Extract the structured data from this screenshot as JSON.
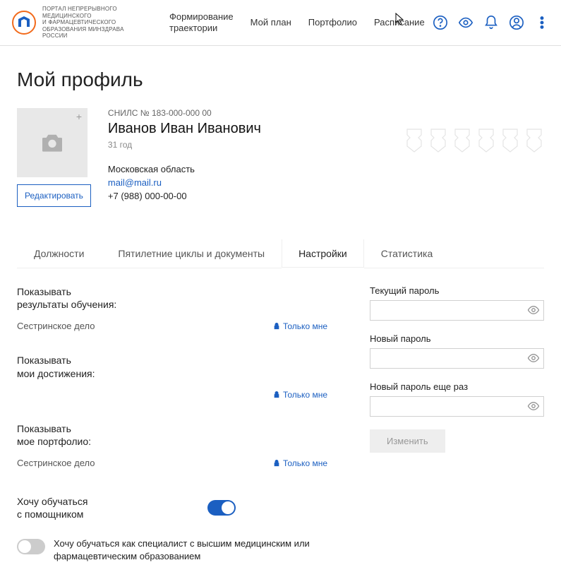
{
  "header": {
    "org_line1": "ПОРТАЛ НЕПРЕРЫВНОГО",
    "org_line2": "МЕДИЦИНСКОГО",
    "org_line3": "И ФАРМАЦЕВТИЧЕСКОГО",
    "org_line4": "ОБРАЗОВАНИЯ МИНЗДРАВА РОССИИ",
    "nav": {
      "trajectory_l1": "Формирование",
      "trajectory_l2": "траектории",
      "plan": "Мой план",
      "portfolio": "Портфолио",
      "schedule": "Расписание"
    }
  },
  "page": {
    "title": "Мой профиль",
    "snils": "СНИЛС № 183-000-000 00",
    "fullname": "Иванов Иван Иванович",
    "age": "31 год",
    "region": "Московская область",
    "email": "mail@mail.ru",
    "phone": "+7 (988) 000-00-00",
    "edit_btn": "Редактировать"
  },
  "tabs": {
    "positions": "Должности",
    "cycles": "Пятилетние циклы и документы",
    "settings": "Настройки",
    "stats": "Статистика"
  },
  "settings": {
    "show_results_l1": "Показывать",
    "show_results_l2": "результаты обучения:",
    "spec1": "Сестринское дело",
    "only_me": "Только мне",
    "show_ach_l1": "Показывать",
    "show_ach_l2": "мои достижения:",
    "show_port_l1": "Показывать",
    "show_port_l2": "мое портфолио:",
    "spec2": "Сестринское дело",
    "assistant_l1": "Хочу обучаться",
    "assistant_l2": "с помощником",
    "higher_ed": "Хочу обучаться как специалист с высшим медицинским или фармацевтическим образованием"
  },
  "password": {
    "current": "Текущий пароль",
    "new": "Новый пароль",
    "repeat": "Новый пароль еще раз",
    "change_btn": "Изменить"
  }
}
